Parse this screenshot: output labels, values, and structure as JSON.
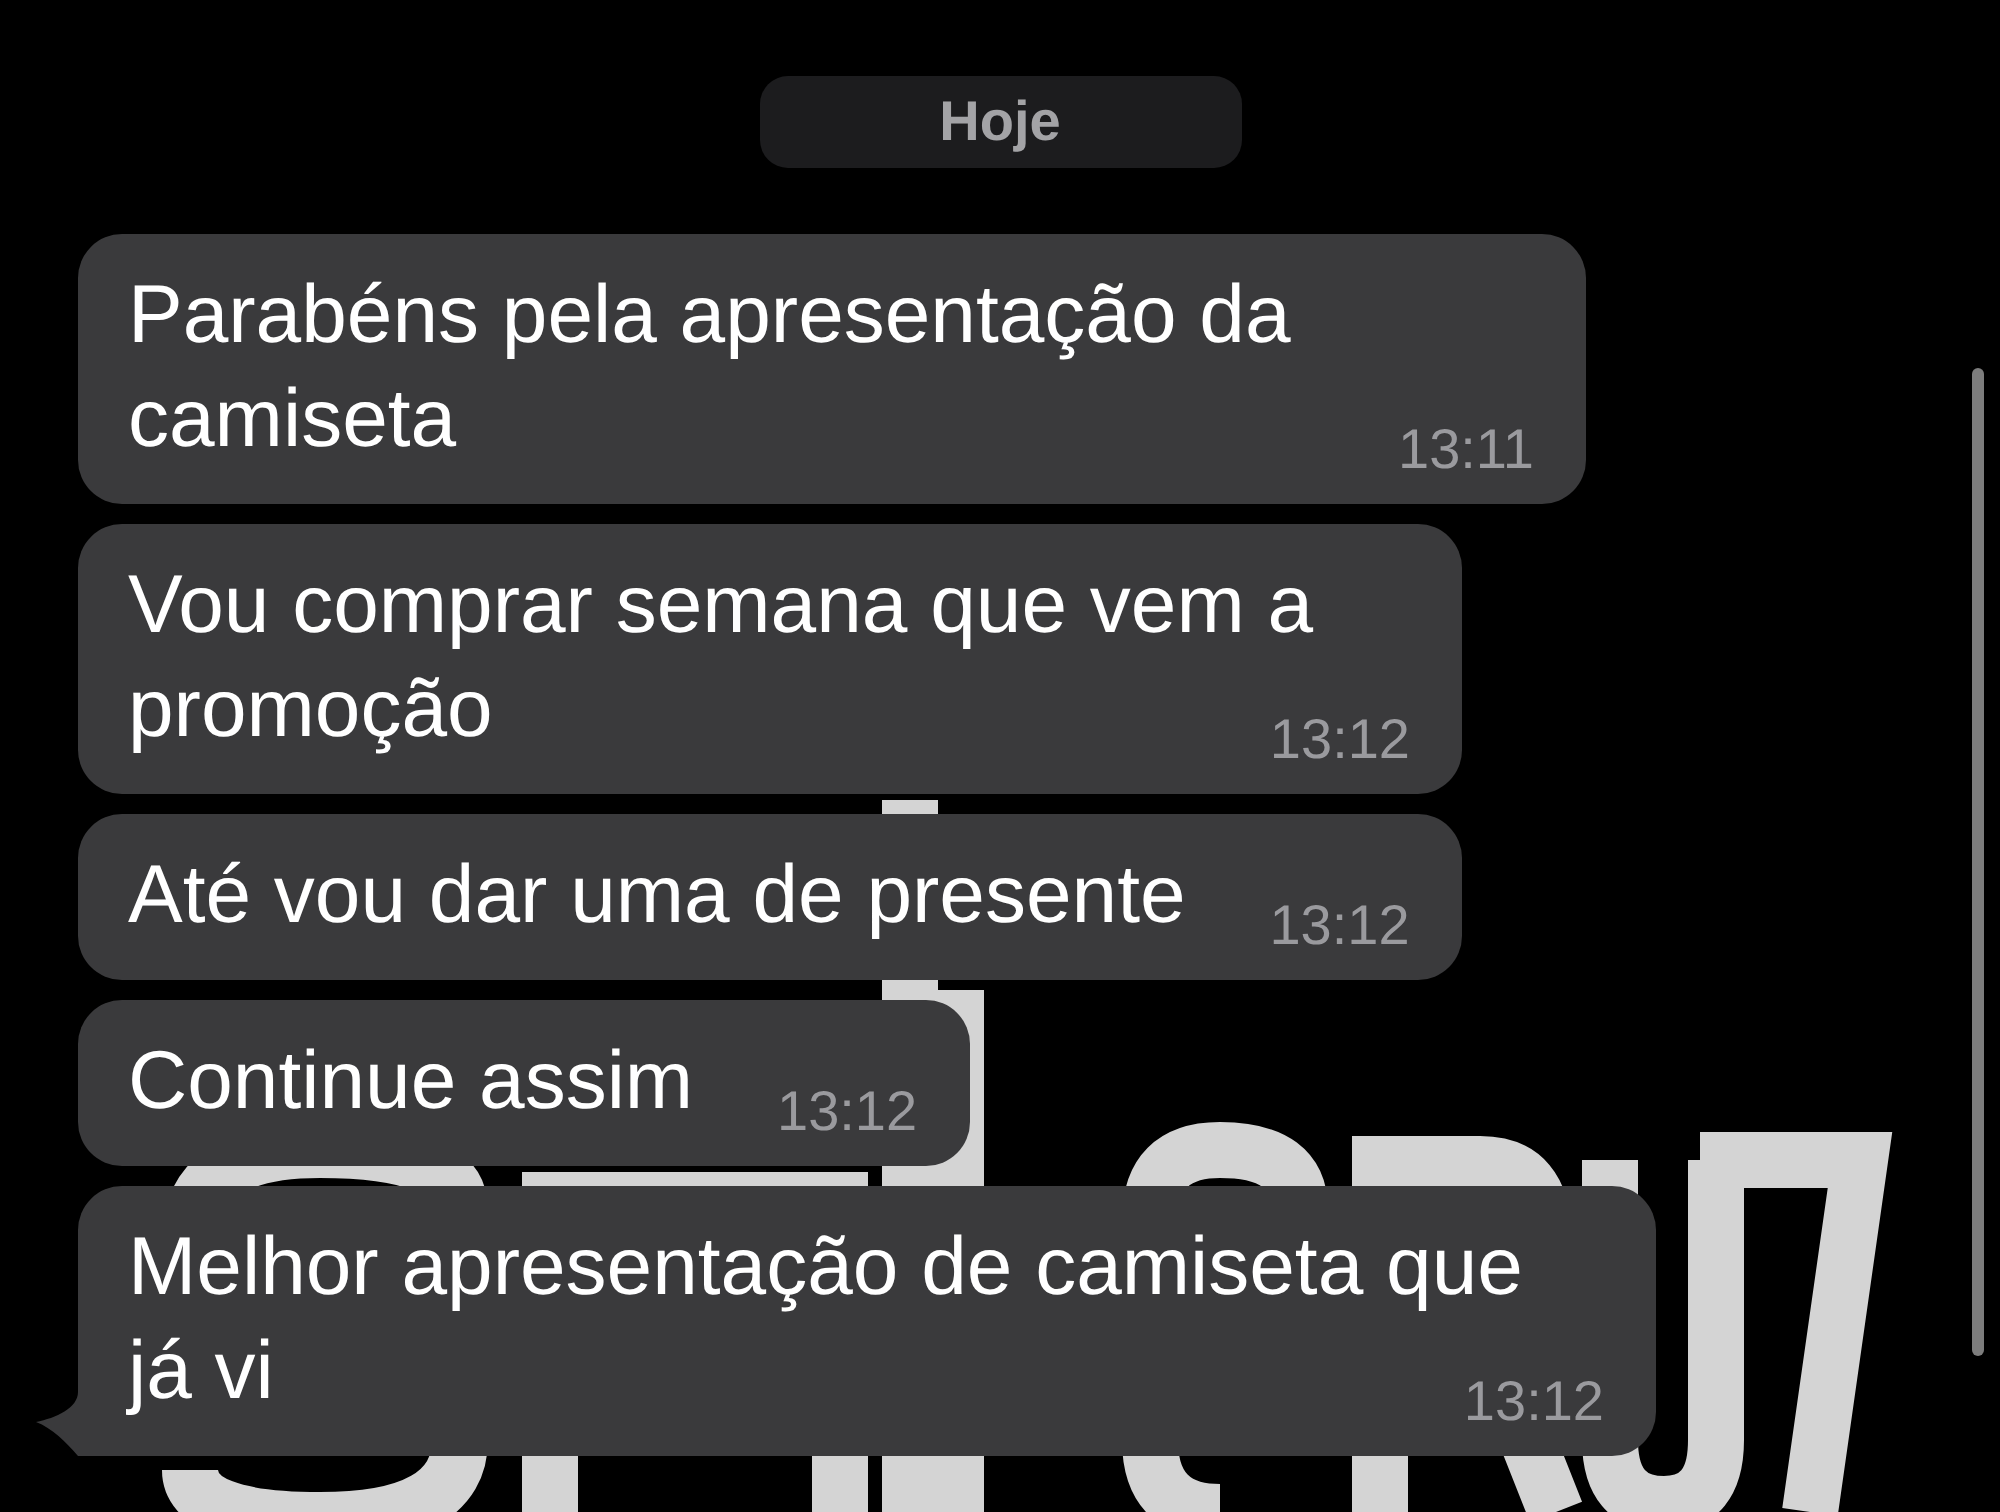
{
  "date_separator": {
    "label": "Hoje"
  },
  "messages": [
    {
      "text": "Parabéns pela apresentação da camiseta",
      "time": "13:11",
      "tail": false
    },
    {
      "text": "Vou comprar semana que vem a promoção",
      "time": "13:12",
      "tail": false
    },
    {
      "text": "Até vou dar uma de presente",
      "time": "13:12",
      "tail": false
    },
    {
      "text": "Continue assim",
      "time": "13:12",
      "tail": false
    },
    {
      "text": "Melhor apresentação de camiseta que já vi",
      "time": "13:12",
      "tail": true
    }
  ]
}
